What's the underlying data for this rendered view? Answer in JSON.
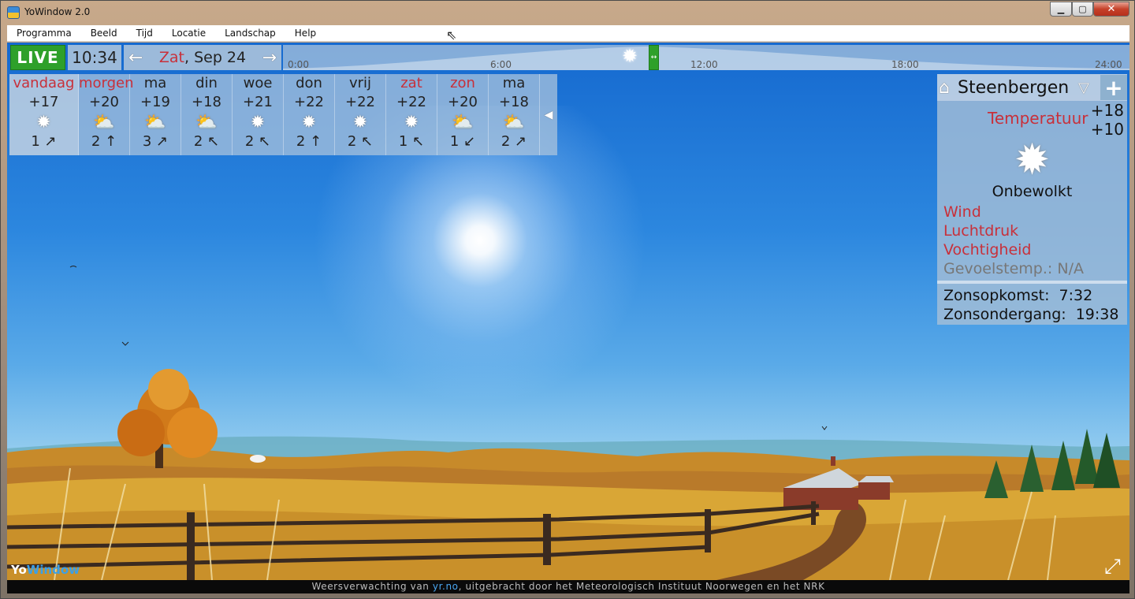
{
  "window": {
    "title": "YoWindow 2.0"
  },
  "menu": [
    "Programma",
    "Beeld",
    "Tijd",
    "Locatie",
    "Landschap",
    "Help"
  ],
  "topbar": {
    "live_label": "LIVE",
    "time": "10:34",
    "date_day": "Zat",
    "date_rest": ", Sep 24",
    "prev_arrow": "←",
    "next_arrow": "→",
    "ticks": [
      "0:00",
      "6:00",
      "12:00",
      "18:00",
      "24:00"
    ]
  },
  "forecast": [
    {
      "day": "vandaag",
      "red": true,
      "temp": "+17",
      "icon": "sun-icon",
      "wind": "1 ↗"
    },
    {
      "day": "morgen",
      "red": true,
      "temp": "+20",
      "icon": "sun-cloud-icon",
      "wind": "2 ↑"
    },
    {
      "day": "ma",
      "red": false,
      "temp": "+19",
      "icon": "sun-cloud-icon",
      "wind": "3 ↗"
    },
    {
      "day": "din",
      "red": false,
      "temp": "+18",
      "icon": "sun-cloud-icon",
      "wind": "2 ↖"
    },
    {
      "day": "woe",
      "red": false,
      "temp": "+21",
      "icon": "sun-icon",
      "wind": "2 ↖"
    },
    {
      "day": "don",
      "red": false,
      "temp": "+22",
      "icon": "sun-icon",
      "wind": "2 ↑"
    },
    {
      "day": "vrij",
      "red": false,
      "temp": "+22",
      "icon": "sun-icon",
      "wind": "2 ↖"
    },
    {
      "day": "zat",
      "red": true,
      "temp": "+22",
      "icon": "sun-icon",
      "wind": "1 ↖"
    },
    {
      "day": "zon",
      "red": true,
      "temp": "+20",
      "icon": "sun-cloud-icon",
      "wind": "1 ↙"
    },
    {
      "day": "ma",
      "red": false,
      "temp": "+18",
      "icon": "sun-cloud-icon",
      "wind": "2 ↗"
    }
  ],
  "panel": {
    "city": "Steenbergen",
    "temp_label": "Temperatuur",
    "temp_max": "+18",
    "temp_min": "+10",
    "condition": "Onbewolkt",
    "wind_label": "Wind",
    "pressure_label": "Luchtdruk",
    "humidity_label": "Vochtigheid",
    "feels_label": "Gevoelstemp.:",
    "feels_value": "N/A",
    "sunrise_label": "Zonsopkomst:",
    "sunrise_value": "7:32",
    "sunset_label": "Zonsondergang:",
    "sunset_value": "19:38"
  },
  "footer": {
    "prefix": "Weersverwachting van ",
    "link": "yr.no",
    "suffix": ", uitgebracht door het Meteorologisch Instituut Noorwegen en het NRK"
  },
  "logo": {
    "part1": "Yo",
    "part2": "Window"
  },
  "colors": {
    "accent_red": "#c8303a",
    "live_green": "#2ea02a",
    "sky_top": "#1569cf"
  }
}
